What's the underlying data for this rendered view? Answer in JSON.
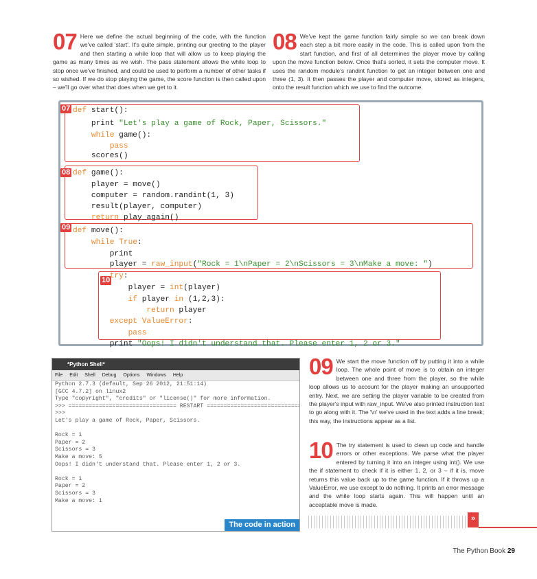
{
  "step07": {
    "num": "07",
    "text": "Here we define the actual beginning of the code, with the function we've called 'start'. It's quite simple, printing our greeting to the player and then starting a while loop that will allow us to keep playing the game as many times as we wish. The pass statement allows the while loop to stop once we've finished, and could be used to perform a number of other tasks if so wished. If we do stop playing the game, the score function is then called upon – we'll go over what that does when we get to it."
  },
  "step08": {
    "num": "08",
    "text": "We've kept the game function fairly simple so we can break down each step a bit more easily in the code. This is called upon from the start function, and first of all determines the player move by calling upon the move function below. Once that's sorted, it sets the computer move. It uses the random module's randint function to get an integer between one and three (1, 3). It then passes the player and computer move, stored as integers, onto the result function which we use to find the outcome."
  },
  "step09": {
    "num": "09",
    "text": "We start the move function off by putting it into a while loop. The whole point of move is to obtain an integer between one and three from the player, so the while loop allows us to account for the player making an unsupported entry. Next, we are setting the player variable to be created from the player's input with raw_input. We've also printed instruction text to go along with it. The '\\n' we've used in the text adds a line break; this way, the instructions appear as a list."
  },
  "step10": {
    "num": "10",
    "text": "The try statement is used to clean up code and handle errors or other exceptions. We parse what the player entered by turning it into an integer using int(). We use the if statement to check if it is either 1, 2, or 3 – if it is, move returns this value back up to the game function. If it throws up a ValueError, we use except to do nothing. It prints an error message and the while loop starts again. This will happen until an acceptable move is made."
  },
  "code": {
    "tags": [
      "07",
      "08",
      "09",
      "10"
    ],
    "lines": [
      {
        "id": "c1",
        "parts": [
          [
            "kw",
            "def "
          ],
          [
            "plain",
            "start():"
          ]
        ]
      },
      {
        "id": "c2",
        "parts": [
          [
            "plain",
            "    print "
          ],
          [
            "str",
            "\"Let's play a game of Rock, Paper, Scissors.\""
          ]
        ]
      },
      {
        "id": "c3",
        "parts": [
          [
            "kw",
            "    while "
          ],
          [
            "plain",
            "game():"
          ]
        ]
      },
      {
        "id": "c4",
        "parts": [
          [
            "kw",
            "        pass"
          ]
        ]
      },
      {
        "id": "c5",
        "parts": [
          [
            "plain",
            "    scores()"
          ]
        ]
      },
      {
        "id": "c6",
        "parts": [
          [
            "kw",
            "def "
          ],
          [
            "plain",
            "game():"
          ]
        ]
      },
      {
        "id": "c7",
        "parts": [
          [
            "plain",
            "    player = move()"
          ]
        ]
      },
      {
        "id": "c8",
        "parts": [
          [
            "plain",
            "    computer = random.randint(1, 3)"
          ]
        ]
      },
      {
        "id": "c9",
        "parts": [
          [
            "plain",
            "    result(player, computer)"
          ]
        ]
      },
      {
        "id": "c10",
        "parts": [
          [
            "kw",
            "    return "
          ],
          [
            "plain",
            "play_again()"
          ]
        ]
      },
      {
        "id": "c11",
        "parts": [
          [
            "kw",
            "def "
          ],
          [
            "plain",
            "move():"
          ]
        ]
      },
      {
        "id": "c12",
        "parts": [
          [
            "kw",
            "    while True"
          ],
          [
            "plain",
            ":"
          ]
        ]
      },
      {
        "id": "c13",
        "parts": [
          [
            "plain",
            "        print"
          ]
        ]
      },
      {
        "id": "c14",
        "parts": [
          [
            "plain",
            "        player = "
          ],
          [
            "kw",
            "raw_input"
          ],
          [
            "plain",
            "("
          ],
          [
            "str",
            "\"Rock = 1\\nPaper = 2\\nScissors = 3\\nMake a move: \""
          ],
          [
            "plain",
            ")"
          ]
        ]
      },
      {
        "id": "c15",
        "parts": [
          [
            "kw",
            "        try"
          ],
          [
            "plain",
            ":"
          ]
        ]
      },
      {
        "id": "c16",
        "parts": [
          [
            "plain",
            "            player = "
          ],
          [
            "kw",
            "int"
          ],
          [
            "plain",
            "(player)"
          ]
        ]
      },
      {
        "id": "c17",
        "parts": [
          [
            "kw",
            "            if "
          ],
          [
            "plain",
            "player "
          ],
          [
            "kw",
            "in "
          ],
          [
            "plain",
            "(1,2,3):"
          ]
        ]
      },
      {
        "id": "c18",
        "parts": [
          [
            "kw",
            "                return "
          ],
          [
            "plain",
            "player"
          ]
        ]
      },
      {
        "id": "c19",
        "parts": [
          [
            "kw",
            "        except ValueError"
          ],
          [
            "plain",
            ":"
          ]
        ]
      },
      {
        "id": "c20",
        "parts": [
          [
            "kw",
            "            pass"
          ]
        ]
      },
      {
        "id": "c21",
        "parts": [
          [
            "plain",
            "        print "
          ],
          [
            "str",
            "\"Oops! I didn't understand that. Please enter 1, 2 or 3.\""
          ]
        ]
      }
    ]
  },
  "shell": {
    "title": "*Python Shell*",
    "menu": [
      "File",
      "Edit",
      "Shell",
      "Debug",
      "Options",
      "Windows",
      "Help"
    ],
    "lines": [
      "Python 2.7.3 (default, Sep 26 2012, 21:51:14)",
      "[GCC 4.7.2] on linux2",
      "Type \"copyright\", \"credits\" or \"license()\" for more information.",
      ">>> ================================ RESTART ================================",
      ">>>",
      "Let's play a game of Rock, Paper, Scissors.",
      "",
      "Rock = 1",
      "Paper = 2",
      "Scissors = 3",
      "Make a move: 5",
      "Oops! I didn't understand that. Please enter 1, 2 or 3.",
      "",
      "Rock = 1",
      "Paper = 2",
      "Scissors = 3",
      "Make a move: 1"
    ],
    "caption": "The code in action"
  },
  "footer": {
    "book": "The Python Book",
    "page": "29"
  },
  "arrow": "»",
  "colors": {
    "accent": "#e2403f",
    "caption_bg": "#2a86c8",
    "keyword": "#e8862c",
    "string": "#3a8f2e"
  }
}
